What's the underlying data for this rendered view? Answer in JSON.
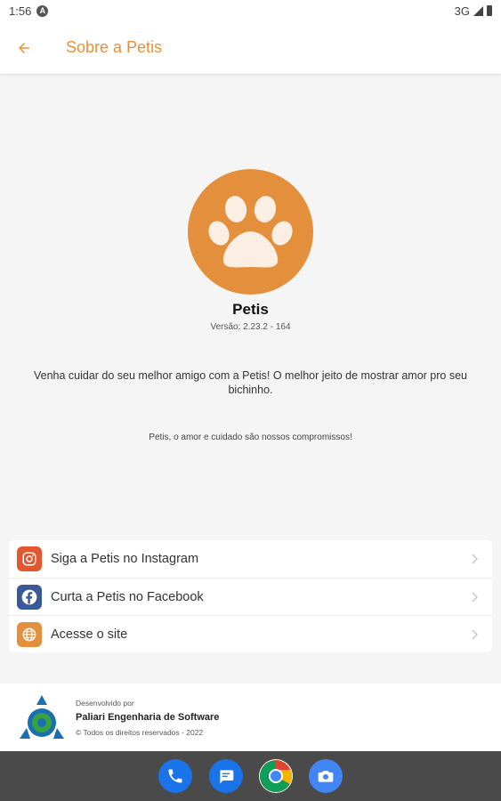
{
  "status_bar": {
    "time": "1:56",
    "network": "3G",
    "notification_icon": "a-icon"
  },
  "header": {
    "title": "Sobre a Petis",
    "back_icon": "arrow-left-icon"
  },
  "about": {
    "app_name": "Petis",
    "version": "Versão: 2.23.2 - 164",
    "description": "Venha cuidar do seu melhor amigo com a Petis! O melhor jeito de mostrar amor pro seu bichinho.",
    "slogan": "Petis, o amor e cuidado são nossos compromissos!",
    "logo_icon": "paw-icon"
  },
  "links": [
    {
      "label": "Siga a Petis no Instagram",
      "icon": "instagram-icon",
      "color": "#e4572e"
    },
    {
      "label": "Curta a Petis no Facebook",
      "icon": "facebook-icon",
      "color": "#3b5998"
    },
    {
      "label": "Acesse o site",
      "icon": "globe-icon",
      "color": "#e48f3b"
    }
  ],
  "footer": {
    "caption": "Desenvolvido por",
    "company": "Paliari Engenharia de Software",
    "rights": "© Todos os direitos reservados - 2022"
  },
  "dock": [
    {
      "icon": "phone-icon"
    },
    {
      "icon": "messages-icon"
    },
    {
      "icon": "chrome-icon"
    },
    {
      "icon": "camera-icon"
    }
  ],
  "colors": {
    "accent": "#e8913a",
    "logo": "#e48f3b",
    "nav_bar": "#4a4a4a"
  }
}
